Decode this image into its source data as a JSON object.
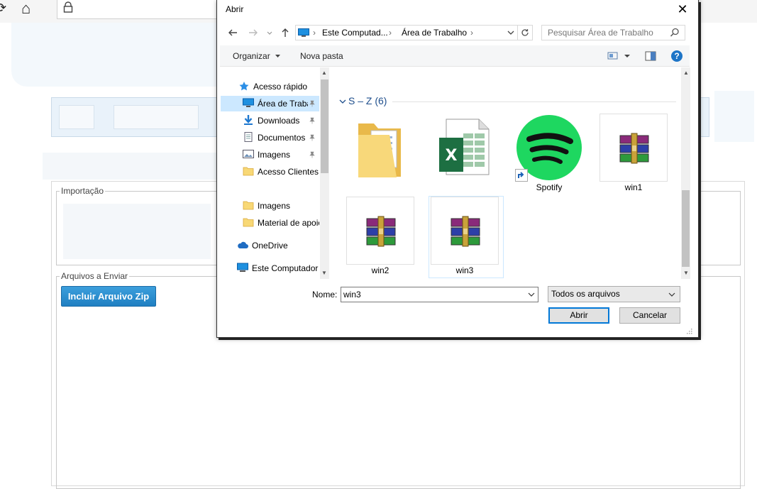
{
  "browser": {
    "refresh_glyph": "⟳",
    "home_glyph": "⌂",
    "lock_glyph": "🔒"
  },
  "page": {
    "importacao_legend": "Importação",
    "arquivos_legend": "Arquivos a Enviar",
    "zip_button_label": "Incluir Arquivo Zip",
    "accent_color": "#2a8ed3"
  },
  "dialog": {
    "title": "Abrir",
    "close_glyph": "✕",
    "address": {
      "segments": [
        "Este Computad...",
        "Área de Trabalho"
      ],
      "separator": "›"
    },
    "search_placeholder": "Pesquisar Área de Trabalho",
    "toolbar": {
      "organize_label": "Organizar",
      "new_folder_label": "Nova pasta",
      "help_glyph": "?"
    },
    "nav": {
      "quick_access": "Acesso rápido",
      "items": [
        {
          "label": "Área de Trabalho",
          "icon": "desktop-icon",
          "pinned": true
        },
        {
          "label": "Downloads",
          "icon": "download-icon",
          "pinned": true
        },
        {
          "label": "Documentos",
          "icon": "document-icon",
          "pinned": true
        },
        {
          "label": "Imagens",
          "icon": "image-icon",
          "pinned": true
        },
        {
          "label": "Acesso Clientes",
          "icon": "folder-icon",
          "pinned": false
        },
        {
          "label": "Imagens",
          "icon": "folder-icon",
          "pinned": false
        },
        {
          "label": "Material de apoio",
          "icon": "folder-icon",
          "pinned": false
        }
      ],
      "onedrive": "OneDrive",
      "this_pc": "Este Computador",
      "pin_glyph": "📌"
    },
    "group_header": "S – Z (6)",
    "files": [
      {
        "label": "",
        "icon": "folder-icon"
      },
      {
        "label": "",
        "icon": "excel-file-icon"
      },
      {
        "label": "Spotify",
        "icon": "spotify-icon"
      },
      {
        "label": "win1",
        "icon": "winrar-archive-icon"
      },
      {
        "label": "win2",
        "icon": "winrar-archive-icon"
      },
      {
        "label": "win3",
        "icon": "winrar-archive-icon"
      }
    ],
    "filename_label": "Nome:",
    "filename_value": "win3",
    "filter_value": "Todos os arquivos",
    "open_button": "Abrir",
    "cancel_button": "Cancelar"
  }
}
